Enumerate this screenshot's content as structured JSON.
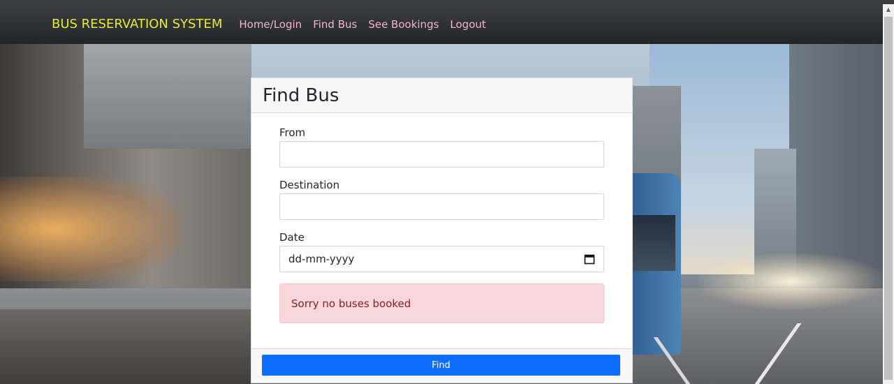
{
  "navbar": {
    "brand": "BUS RESERVATION SYSTEM",
    "links": [
      "Home/Login",
      "Find Bus",
      "See Bookings",
      "Logout"
    ]
  },
  "card": {
    "title": "Find Bus",
    "fields": {
      "from_label": "From",
      "from_value": "",
      "destination_label": "Destination",
      "destination_value": "",
      "date_label": "Date",
      "date_placeholder": "dd-mm-yyyy"
    },
    "alert": "Sorry no buses booked",
    "find_label": "Find"
  },
  "colors": {
    "brand": "#e8ec2a",
    "nav_link": "#f3b3cc",
    "primary_button": "#0d6efd",
    "alert_bg": "#f8d7da",
    "alert_text": "#842029"
  },
  "icons": {
    "date_picker": "calendar-icon"
  }
}
